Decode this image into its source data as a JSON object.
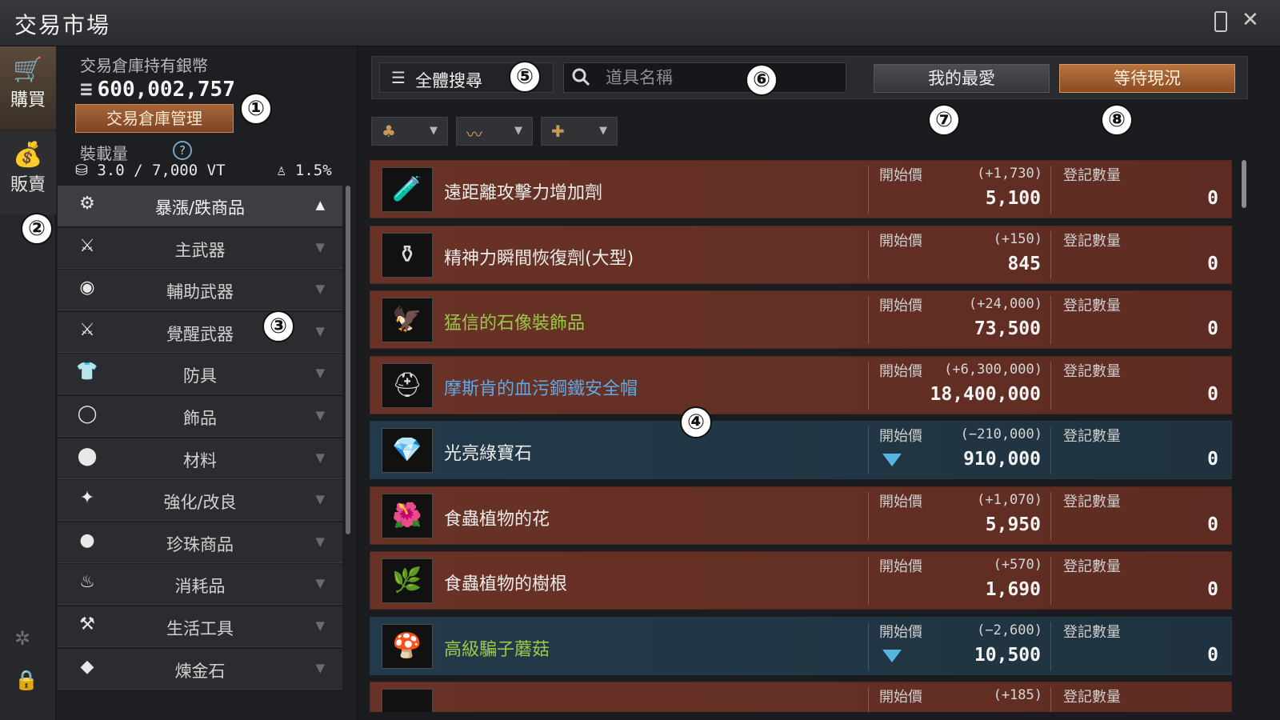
{
  "window": {
    "title": "交易市場"
  },
  "leftnav": {
    "buy_label": "購買",
    "sell_label": "販賣"
  },
  "wallet": {
    "caption": "交易倉庫持有銀幣",
    "silver": "600,002,757",
    "manage_button": "交易倉庫管理",
    "weight_caption": "裝載量",
    "weight_help": "?",
    "weight_value": "3.0 / 7,000 VT",
    "weight_percent": "1.5%"
  },
  "categories": [
    {
      "label": "暴漲/跌商品",
      "icon": "gear-icon",
      "glyph": "⚙",
      "active": true,
      "arrow": "▲"
    },
    {
      "label": "主武器",
      "icon": "sword-icon",
      "glyph": "⚔",
      "arrow": "▼"
    },
    {
      "label": "輔助武器",
      "icon": "shield-icon",
      "glyph": "◉",
      "arrow": "▼"
    },
    {
      "label": "覺醒武器",
      "icon": "awakening-sword-icon",
      "glyph": "⚔",
      "arrow": "▼"
    },
    {
      "label": "防具",
      "icon": "armor-icon",
      "glyph": "👕",
      "arrow": "▼"
    },
    {
      "label": "飾品",
      "icon": "ring-icon",
      "glyph": "◯",
      "arrow": "▼"
    },
    {
      "label": "材料",
      "icon": "material-icon",
      "glyph": "⬤",
      "arrow": "▼"
    },
    {
      "label": "強化/改良",
      "icon": "enhance-icon",
      "glyph": "✦",
      "arrow": "▼"
    },
    {
      "label": "珍珠商品",
      "icon": "pearl-icon",
      "glyph": "●",
      "arrow": "▼"
    },
    {
      "label": "消耗品",
      "icon": "potion-icon",
      "glyph": "♨",
      "arrow": "▼"
    },
    {
      "label": "生活工具",
      "icon": "tools-icon",
      "glyph": "⚒",
      "arrow": "▼"
    },
    {
      "label": "煉金石",
      "icon": "alchemy-stone-icon",
      "glyph": "◆",
      "arrow": "▼"
    }
  ],
  "search": {
    "all_search_label": "全體搜尋",
    "placeholder": "道具名稱",
    "favorites_button": "我的最愛",
    "waiting_button": "等待現況"
  },
  "filters": [
    {
      "icon": "bag-filter-icon",
      "glyph": "♣"
    },
    {
      "icon": "trend-filter-icon",
      "glyph": "〰"
    },
    {
      "icon": "plus-filter-icon",
      "glyph": "✚"
    }
  ],
  "labels": {
    "start_price": "開始價",
    "registered_qty": "登記數量"
  },
  "items": [
    {
      "name": "遠距離攻擊力增加劑",
      "change": "(+1,730)",
      "price": "5,100",
      "qty": "0",
      "trend": "up",
      "name_color": "white",
      "icon": "green-potion-icon",
      "glyph": "🧪"
    },
    {
      "name": "精神力瞬間恢復劑(大型)",
      "change": "(+150)",
      "price": "845",
      "qty": "0",
      "trend": "up",
      "name_color": "white",
      "icon": "blue-potion-icon",
      "glyph": "⚱"
    },
    {
      "name": "猛信的石像裝飾品",
      "change": "(+24,000)",
      "price": "73,500",
      "qty": "0",
      "trend": "up",
      "name_color": "green",
      "icon": "gargoyle-ornament-icon",
      "glyph": "🦅"
    },
    {
      "name": "摩斯肯的血污鋼鐵安全帽",
      "change": "(+6,300,000)",
      "price": "18,400,000",
      "qty": "0",
      "trend": "up",
      "name_color": "blue",
      "icon": "helmet-icon",
      "glyph": "⛑"
    },
    {
      "name": "光亮綠寶石",
      "change": "(−210,000)",
      "price": "910,000",
      "qty": "0",
      "trend": "down",
      "name_color": "white",
      "icon": "emerald-icon",
      "glyph": "💎"
    },
    {
      "name": "食蟲植物的花",
      "change": "(+1,070)",
      "price": "5,950",
      "qty": "0",
      "trend": "up",
      "name_color": "white",
      "icon": "flower-icon",
      "glyph": "🌺"
    },
    {
      "name": "食蟲植物的樹根",
      "change": "(+570)",
      "price": "1,690",
      "qty": "0",
      "trend": "up",
      "name_color": "white",
      "icon": "root-icon",
      "glyph": "🌿"
    },
    {
      "name": "高級騙子蘑菇",
      "change": "(−2,600)",
      "price": "10,500",
      "qty": "0",
      "trend": "down",
      "name_color": "green",
      "icon": "mushroom-icon",
      "glyph": "🍄"
    },
    {
      "name": "",
      "change": "(+185)",
      "price": "",
      "qty": "",
      "trend": "up",
      "name_color": "white",
      "icon": "item-icon",
      "glyph": ""
    }
  ],
  "annotations": [
    "①",
    "②",
    "③",
    "④",
    "⑤",
    "⑥",
    "⑦",
    "⑧"
  ]
}
